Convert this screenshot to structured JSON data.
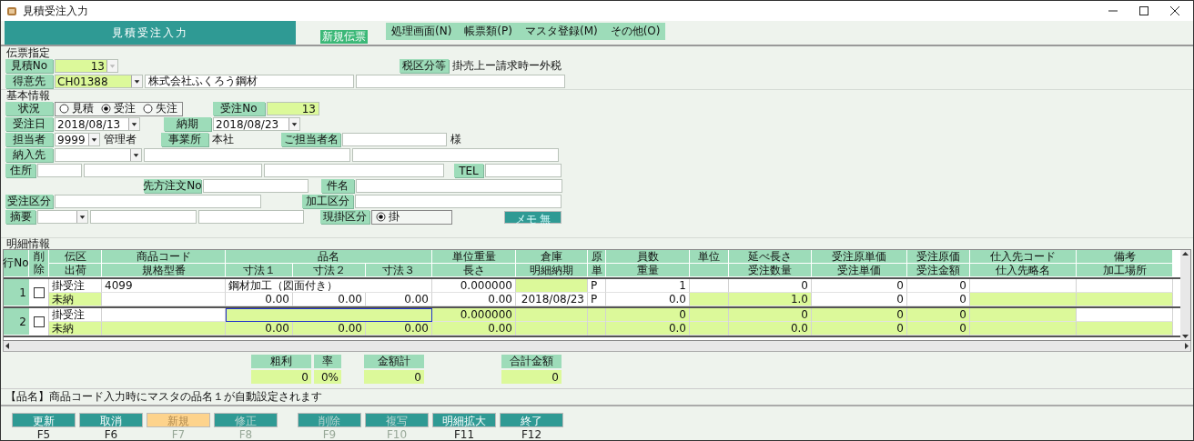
{
  "window": {
    "title": "見積受注入力"
  },
  "header": {
    "title": "見積受注入力",
    "badge": "新規伝票",
    "menu": [
      "処理画面(N)",
      "帳票類(P)",
      "マスタ登録(M)",
      "その他(O)"
    ]
  },
  "slip": {
    "section": "伝票指定",
    "estimate_no": {
      "label": "見積No",
      "value": "13",
      "dropdown_disabled": true
    },
    "tax": {
      "label": "税区分等",
      "value": "掛売上ー請求時ー外税"
    },
    "customer": {
      "label": "得意先",
      "code": "CH01388",
      "name": "株式会社ふくろう鋼材"
    }
  },
  "basic": {
    "section": "基本情報",
    "status": {
      "label": "状況",
      "options": [
        {
          "label": "見積",
          "selected": false
        },
        {
          "label": "受注",
          "selected": true
        },
        {
          "label": "失注",
          "selected": false
        }
      ]
    },
    "order_no": {
      "label": "受注No",
      "value": "13"
    },
    "order_date": {
      "label": "受注日",
      "value": "2018/08/13"
    },
    "delivery_date": {
      "label": "納期",
      "value": "2018/08/23"
    },
    "staff": {
      "label": "担当者",
      "code": "9999",
      "name": "管理者"
    },
    "office": {
      "label": "事業所",
      "value": "本社"
    },
    "contact": {
      "label": "ご担当者名",
      "suffix": "様"
    },
    "ship_to": {
      "label": "納入先"
    },
    "address": {
      "label": "住所"
    },
    "tel": {
      "label": "TEL"
    },
    "customer_order_no": {
      "label": "先方注文No"
    },
    "subject": {
      "label": "件名"
    },
    "order_class": {
      "label": "受注区分"
    },
    "processing_class": {
      "label": "加工区分"
    },
    "summary": {
      "label": "摘要"
    },
    "payment": {
      "label": "現掛区分",
      "options": [
        {
          "label": "掛",
          "selected": true
        }
      ]
    },
    "memo_button": "メモ 無"
  },
  "details": {
    "section": "明細情報",
    "row_no_header": "行No",
    "delete_header": "削除",
    "header_top": [
      {
        "text": "伝区"
      },
      {
        "text": "商品コード"
      },
      {
        "text": "品名"
      },
      {
        "text": "単位重量"
      },
      {
        "text": "倉庫"
      },
      {
        "text": "原"
      },
      {
        "text": "員数"
      },
      {
        "text": "単位"
      },
      {
        "text": "延べ長さ"
      },
      {
        "text": "受注原単価"
      },
      {
        "text": "受注原価"
      },
      {
        "text": "仕入先コード"
      },
      {
        "text": "備考"
      }
    ],
    "header_bottom": [
      {
        "text": "出荷"
      },
      {
        "text": "規格型番"
      },
      {
        "text": "寸法１"
      },
      {
        "text": "寸法２"
      },
      {
        "text": "寸法３"
      },
      {
        "text": "長さ"
      },
      {
        "text": "明細納期"
      },
      {
        "text": "単"
      },
      {
        "text": "重量"
      },
      {
        "text": "受注数量"
      },
      {
        "text": "受注単価"
      },
      {
        "text": "受注金額"
      },
      {
        "text": "仕入先略名"
      },
      {
        "text": "加工場所"
      }
    ],
    "rows": [
      {
        "row_no": "1",
        "deleted": false,
        "lines": [
          [
            {
              "text": "掛受注",
              "highlighted": false
            },
            {
              "text": "4099",
              "highlighted": false
            },
            {
              "text": "鋼材加工（図面付き）",
              "highlighted": false
            },
            {
              "text": "0.000000",
              "highlighted": false
            },
            {
              "highlighted": true
            },
            {
              "text": "P",
              "highlighted": false
            },
            {
              "text": "1",
              "highlighted": false
            },
            {
              "highlighted": false
            },
            {
              "text": "0",
              "highlighted": false
            },
            {
              "text": "0",
              "highlighted": false
            },
            {
              "text": "0",
              "highlighted": false
            },
            {
              "highlighted": false
            },
            {
              "highlighted": false
            }
          ],
          [
            {
              "text": "未納",
              "highlighted": true
            },
            {
              "highlighted": false
            },
            {
              "text": "0.00",
              "highlighted": false
            },
            {
              "text": "0.00",
              "highlighted": false
            },
            {
              "text": "0.00",
              "highlighted": false
            },
            {
              "text": "0.00",
              "highlighted": false
            },
            {
              "text": "2018/08/23",
              "highlighted": false
            },
            {
              "text": "P",
              "highlighted": false
            },
            {
              "text": "0.0",
              "highlighted": false
            },
            {
              "highlighted": true
            },
            {
              "text": "1.0",
              "highlighted": true
            },
            {
              "text": "0",
              "highlighted": false
            },
            {
              "text": "0",
              "highlighted": false
            },
            {
              "highlighted": true
            },
            {
              "highlighted": true
            }
          ]
        ]
      },
      {
        "row_no": "2",
        "deleted": false,
        "lines": [
          [
            {
              "text": "掛受注",
              "highlighted": false
            },
            {
              "highlighted": false
            },
            {
              "highlighted": true,
              "focused": true
            },
            {
              "text": "0.000000",
              "highlighted": true
            },
            {
              "highlighted": true
            },
            {
              "highlighted": true
            },
            {
              "text": "0",
              "highlighted": true
            },
            {
              "highlighted": true
            },
            {
              "text": "0",
              "highlighted": true
            },
            {
              "text": "0",
              "highlighted": true
            },
            {
              "text": "0",
              "highlighted": true
            },
            {
              "highlighted": true
            },
            {
              "highlighted": false
            }
          ],
          [
            {
              "text": "未納",
              "highlighted": true
            },
            {
              "highlighted": true
            },
            {
              "text": "0.00",
              "highlighted": true
            },
            {
              "text": "0.00",
              "highlighted": true
            },
            {
              "text": "0.00",
              "highlighted": true
            },
            {
              "text": "0.00",
              "highlighted": true
            },
            {
              "highlighted": true
            },
            {
              "highlighted": true
            },
            {
              "text": "0.0",
              "highlighted": true
            },
            {
              "highlighted": true
            },
            {
              "text": "0.0",
              "highlighted": true
            },
            {
              "text": "0",
              "highlighted": true
            },
            {
              "text": "0",
              "highlighted": true
            },
            {
              "highlighted": true
            },
            {
              "highlighted": true
            }
          ]
        ]
      }
    ]
  },
  "totals": [
    [
      {
        "label": "粗利",
        "value": "0"
      },
      {
        "label": "率",
        "value": "0%"
      }
    ],
    [
      {
        "label": "金額計",
        "value": "0"
      }
    ],
    [
      {
        "label": "合計金額",
        "value": "0"
      }
    ]
  ],
  "message": "【品名】商品コード入力時にマスタの品名１が自動設定されます",
  "buttons": [
    {
      "label": "更新",
      "key": "F5",
      "disabled": false,
      "highlighted": false
    },
    {
      "label": "取消",
      "key": "F6",
      "disabled": false,
      "highlighted": false
    },
    {
      "label": "新規",
      "key": "F7",
      "disabled": true,
      "highlighted": true
    },
    {
      "label": "修正",
      "key": "F8",
      "disabled": true,
      "highlighted": false
    },
    {
      "label": "削除",
      "key": "F9",
      "disabled": true,
      "highlighted": false
    },
    {
      "label": "複写",
      "key": "F10",
      "disabled": true,
      "highlighted": false
    },
    {
      "label": "明細拡大",
      "key": "F11",
      "disabled": false,
      "highlighted": false
    },
    {
      "label": "終了",
      "key": "F12",
      "disabled": false,
      "highlighted": false
    }
  ]
}
